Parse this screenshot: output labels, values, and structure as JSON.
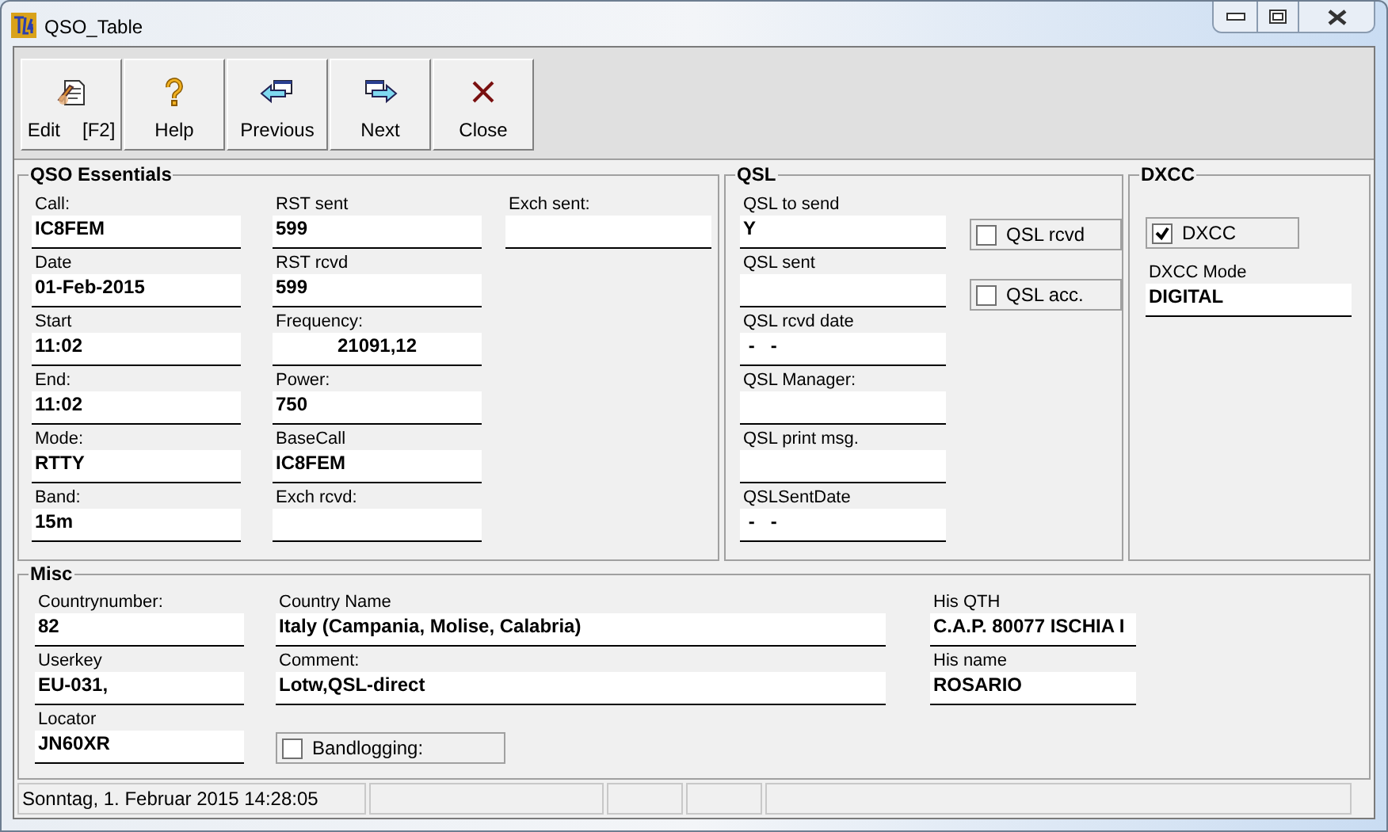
{
  "window": {
    "title": "QSO_Table"
  },
  "toolbar": [
    {
      "label": "Edit",
      "shortcut": "[F2]"
    },
    {
      "label": "Help"
    },
    {
      "label": "Previous"
    },
    {
      "label": "Next"
    },
    {
      "label": "Close"
    }
  ],
  "groups": [
    {
      "title": "QSO Essentials",
      "columns": [
        [
          {
            "kind": "field",
            "label": "Call:",
            "value": "IC8FEM"
          },
          {
            "kind": "field",
            "label": "Date",
            "value": "01-Feb-2015"
          },
          {
            "kind": "field",
            "label": "Start",
            "value": "11:02"
          },
          {
            "kind": "field",
            "label": "End:",
            "value": "11:02"
          },
          {
            "kind": "field",
            "label": "Mode:",
            "value": "RTTY"
          },
          {
            "kind": "field",
            "label": "Band:",
            "value": "15m"
          }
        ],
        [
          {
            "kind": "field",
            "label": "RST sent",
            "value": "599"
          },
          {
            "kind": "field",
            "label": "RST rcvd",
            "value": "599"
          },
          {
            "kind": "number_field",
            "label": "Frequency:",
            "value": "21091,12"
          },
          {
            "kind": "field",
            "label": "Power:",
            "value": "750"
          },
          {
            "kind": "field",
            "label": "BaseCall",
            "value": "IC8FEM"
          },
          {
            "kind": "field",
            "label": "Exch rcvd:"
          }
        ],
        [
          {
            "kind": "field",
            "label": "Exch sent:"
          }
        ]
      ]
    },
    {
      "title": "QSL",
      "columns": [
        [
          {
            "kind": "field",
            "label": "QSL to send",
            "value": "Y"
          },
          {
            "kind": "field",
            "label": "QSL sent"
          },
          {
            "kind": "field",
            "label": "QSL rcvd date",
            "value": " -   -"
          },
          {
            "kind": "field",
            "label": "QSL Manager:"
          },
          {
            "kind": "field",
            "label": "QSL print msg."
          },
          {
            "kind": "field",
            "label": "QSLSentDate",
            "value": " -   -"
          }
        ],
        [
          {
            "kind": "checkbox",
            "label": "QSL rcvd",
            "checked": false
          },
          {
            "kind": "checkbox",
            "label": "QSL acc.",
            "checked": false
          }
        ]
      ]
    },
    {
      "title": "DXCC",
      "columns": [
        [
          {
            "kind": "checkbox",
            "label": "DXCC",
            "checked": true
          },
          {
            "kind": "field",
            "label": "DXCC Mode",
            "value": "DIGITAL"
          }
        ]
      ]
    },
    {
      "title": "Misc",
      "columns": [
        [
          {
            "kind": "field",
            "label": "Countrynumber:",
            "value": "82"
          },
          {
            "kind": "field",
            "label": "Userkey",
            "value": "EU-031,"
          },
          {
            "kind": "field",
            "label": "Locator",
            "value": "JN60XR"
          }
        ],
        [
          {
            "kind": "field",
            "label": "Country Name",
            "value": "Italy (Campania, Molise, Calabria)"
          },
          {
            "kind": "field",
            "label": "Comment:",
            "value": "Lotw,QSL-direct"
          },
          {
            "kind": "checkbox",
            "label": "Bandlogging:",
            "checked": false
          }
        ],
        [
          {
            "kind": "field",
            "label": "His QTH",
            "value": "C.A.P. 80077 ISCHIA I"
          },
          {
            "kind": "field",
            "label": "His name",
            "value": "ROSARIO"
          }
        ]
      ]
    }
  ],
  "status_bar": {
    "text": "Sonntag, 1. Februar 2015 14:28:05"
  }
}
